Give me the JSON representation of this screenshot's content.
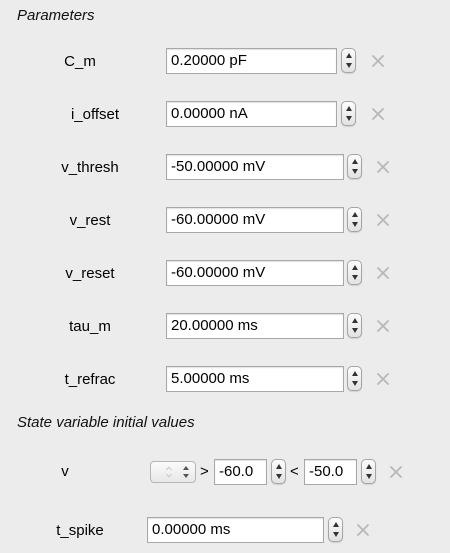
{
  "sections": {
    "parameters": "Parameters",
    "state_vars": "State variable initial values"
  },
  "parameters": [
    {
      "label": "C_m",
      "value": "0.20000 pF"
    },
    {
      "label": "i_offset",
      "value": "0.00000 nA"
    },
    {
      "label": "v_thresh",
      "value": "-50.00000 mV"
    },
    {
      "label": "v_rest",
      "value": "-60.00000 mV"
    },
    {
      "label": "v_reset",
      "value": "-60.00000 mV"
    },
    {
      "label": "tau_m",
      "value": "20.00000 ms"
    },
    {
      "label": "t_refrac",
      "value": "5.00000 ms"
    }
  ],
  "state_variables": {
    "v": {
      "label": "v",
      "gt_symbol": ">",
      "low_value": "-60.0",
      "lt_symbol": "<",
      "high_value": "-50.0"
    },
    "t_spike": {
      "label": "t_spike",
      "value": "0.00000 ms"
    }
  },
  "icons": {
    "stepper": "stepper-icon",
    "clear": "close-icon",
    "popup": "popup-arrows-icon"
  },
  "colors": {
    "background": "#ececec",
    "field_border": "#a8a8a8",
    "clear_icon": "#b8b8b8"
  }
}
